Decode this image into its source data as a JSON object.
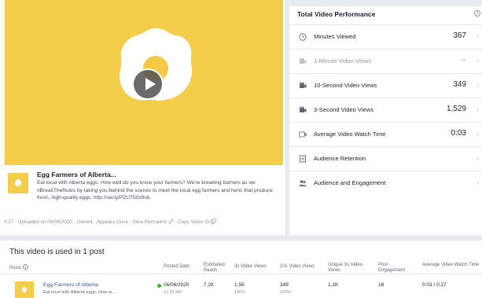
{
  "video": {
    "post_title": "Egg Farmers of Alberta...",
    "post_text": "Eat local with Alberta eggs. How well do you know your farmers? We're breaking barriers as we #BreakTheRules by taking you behind the scenes to meet the local egg farmers and hens that produce fresh, high-quality eggs. http://ow.ly/PZUT50z9vlL",
    "duration": "0:27",
    "uploaded": "Uploaded on 06/06/2020",
    "owned": "Owned",
    "appears": "Appears Once",
    "view_permalink": "View Permalink",
    "copy_video_id": "Copy Video ID",
    "sep": "·",
    "colors": {
      "frame": "#f4cd4b",
      "yolk": "#f7c944"
    }
  },
  "performance": {
    "title": "Total Video Performance",
    "info_glyph": "i",
    "chevron": "›",
    "metrics": [
      {
        "label": "Minutes Viewed",
        "value": "367",
        "icon": "clock-icon"
      },
      {
        "label": "1-Minute Video Views",
        "value": "--",
        "icon": "video-camera-icon"
      },
      {
        "label": "10-Second Video Views",
        "value": "349",
        "icon": "video-camera-icon"
      },
      {
        "label": "3-Second Video Views",
        "value": "1,529",
        "icon": "video-camera-icon"
      },
      {
        "label": "Average Video Watch Time",
        "value": "0:03",
        "icon": "video-play-icon"
      },
      {
        "label": "Audience Retention",
        "value": "",
        "icon": "retention-icon"
      },
      {
        "label": "Audience and Engagement",
        "value": "",
        "icon": "people-icon"
      }
    ]
  },
  "posts": {
    "title": "This video is used in 1 post",
    "columns": {
      "posts": "Posts",
      "posted_date": "Posted Date",
      "reach": "Estimated Reach",
      "views3s": "3s Video Views",
      "views10s": "10s Video Views",
      "unique3s": "Unique 3s Video Views",
      "engagement": "Post Engagement",
      "watch_time": "Average Video Watch Time"
    },
    "row": {
      "name": "Egg Farmers of Alberta",
      "snippet": "Eat local with Alberta eggs. How w...",
      "date": "06/06/2020",
      "time": "11:25 AM",
      "reach": "7.2K",
      "views3s": "1.5K",
      "views3s_pct": "100%",
      "views10s": "349",
      "views10s_pct": "100%",
      "unique3s": "1.2K",
      "engagement": "18",
      "watch_time": "0:03 / 0:27"
    }
  }
}
